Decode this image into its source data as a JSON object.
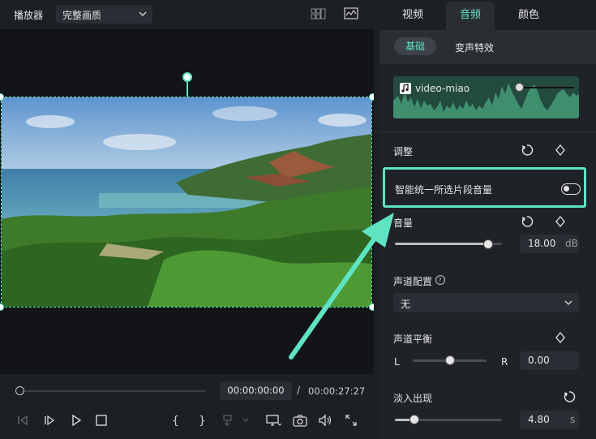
{
  "player": {
    "title": "播放器",
    "quality": "完整画质",
    "current_time": "00:00:00:00",
    "time_separator": "/",
    "total_time": "00:00:27:27",
    "scrub_progress": 0.0
  },
  "tabs": [
    {
      "label": "视频",
      "active": false
    },
    {
      "label": "音频",
      "active": true
    },
    {
      "label": "颜色",
      "active": false
    }
  ],
  "subtabs": [
    {
      "label": "基础",
      "active": true
    },
    {
      "label": "变声特效",
      "active": false
    }
  ],
  "clip": {
    "name": "video-miao",
    "level": 0.0
  },
  "adjust": {
    "title": "调整",
    "smart_normalize_label": "智能统一所选片段音量",
    "smart_normalize_on": false
  },
  "volume": {
    "label": "音量",
    "value": "18.00",
    "unit": "dB",
    "level": 0.87
  },
  "channel": {
    "label": "声道配置",
    "value": "无"
  },
  "balance": {
    "label": "声道平衡",
    "left": "L",
    "right": "R",
    "value": "0.00",
    "level": 0.5
  },
  "fade": {
    "label": "淡入出现",
    "value": "4.80",
    "unit": "s",
    "level": 0.18
  },
  "colors": {
    "accent": "#5fe3c3",
    "panel": "#1f2227",
    "player_bg": "#121417"
  }
}
